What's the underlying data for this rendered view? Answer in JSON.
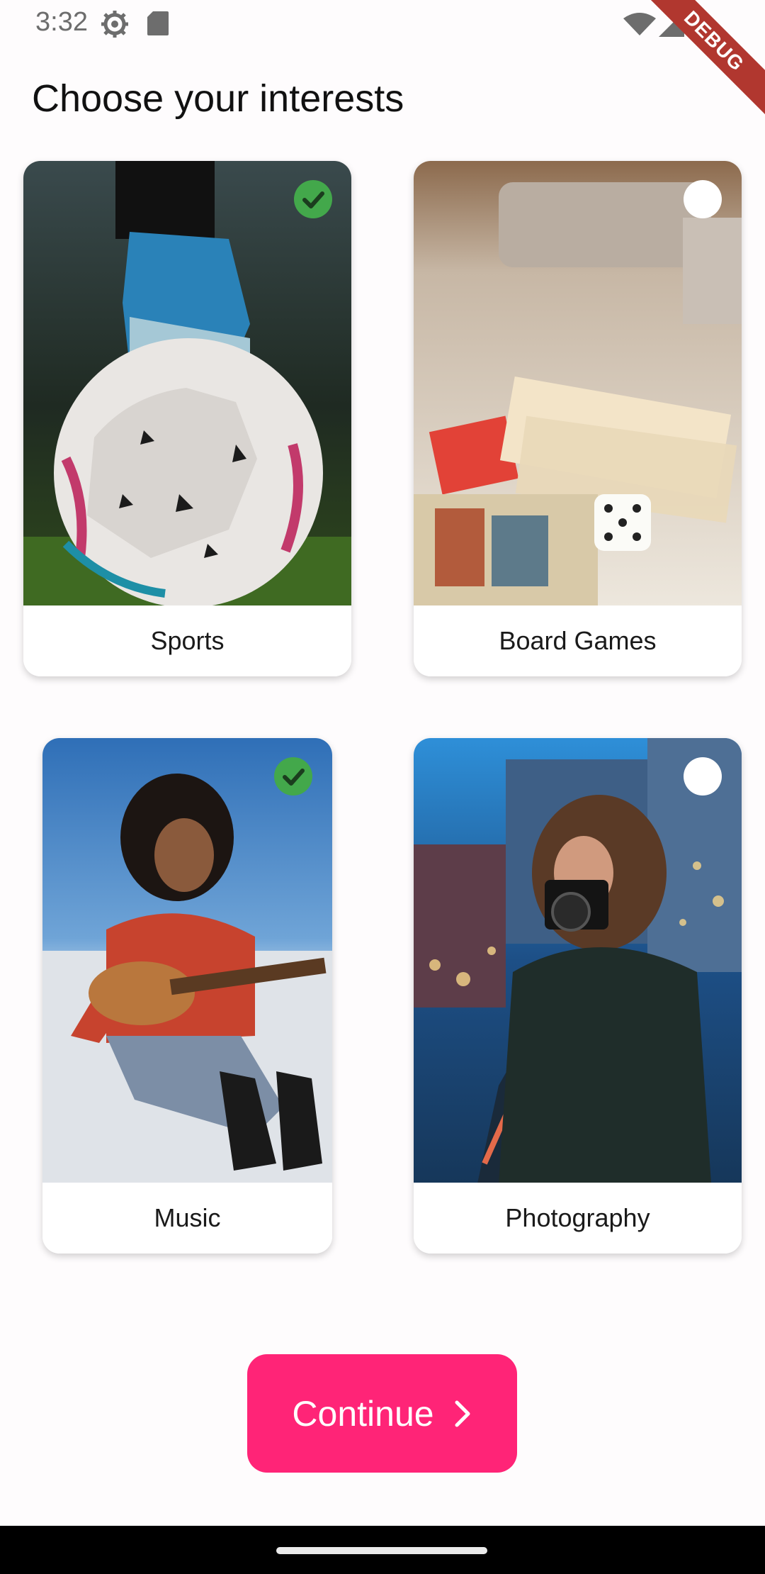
{
  "status_bar": {
    "time": "3:32"
  },
  "debug_label": "DEBUG",
  "page": {
    "title": "Choose your interests"
  },
  "interests": [
    {
      "label": "Sports",
      "selected": true,
      "icon": "soccer-ball-photo"
    },
    {
      "label": "Board Games",
      "selected": false,
      "icon": "board-game-photo"
    },
    {
      "label": "Music",
      "selected": true,
      "icon": "ukulele-photo"
    },
    {
      "label": "Photography",
      "selected": false,
      "icon": "camera-photo"
    }
  ],
  "continue": {
    "label": "Continue",
    "icon": "chevron-right-icon"
  },
  "colors": {
    "accent": "#ff2477",
    "check": "#43a84b",
    "background": "#fefcfd"
  }
}
